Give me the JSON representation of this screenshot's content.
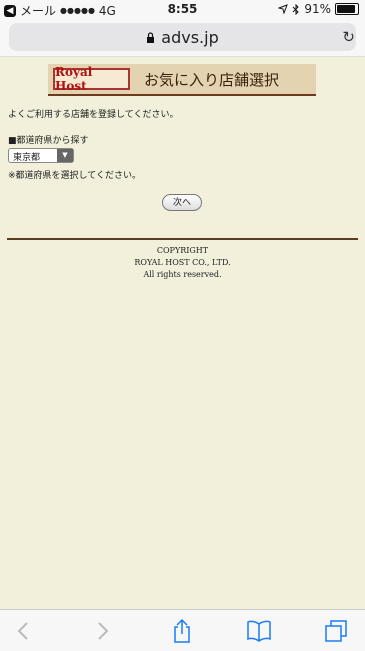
{
  "status": {
    "carrier": "メール",
    "signal": "●●●●●",
    "network": "4G",
    "time": "8:55",
    "battery": "91%",
    "back_icon": "back-arrow-icon"
  },
  "url": {
    "domain": "advs.jp"
  },
  "banner": {
    "logo_text": "Royal Host",
    "title": "お気に入り店舗選択"
  },
  "main": {
    "intro": "よくご利用する店舗を登録してください。",
    "pref_label": "■都道府県から探す",
    "select_value": "東京都",
    "hint": "※都道府県を選択してください。",
    "next_button": "次へ"
  },
  "footer": {
    "line1": "COPYRIGHT",
    "line2": "ROYAL HOST CO., LTD.",
    "line3": "All rights reserved."
  },
  "toolbar": {
    "items": [
      "back-icon",
      "forward-icon",
      "share-icon",
      "bookmarks-icon",
      "tabs-icon"
    ]
  },
  "colors": {
    "page_bg": "#f2efda",
    "accent_dark": "#5a3d22",
    "logo_red": "#b01010",
    "link_blue": "#1a7cf5"
  }
}
